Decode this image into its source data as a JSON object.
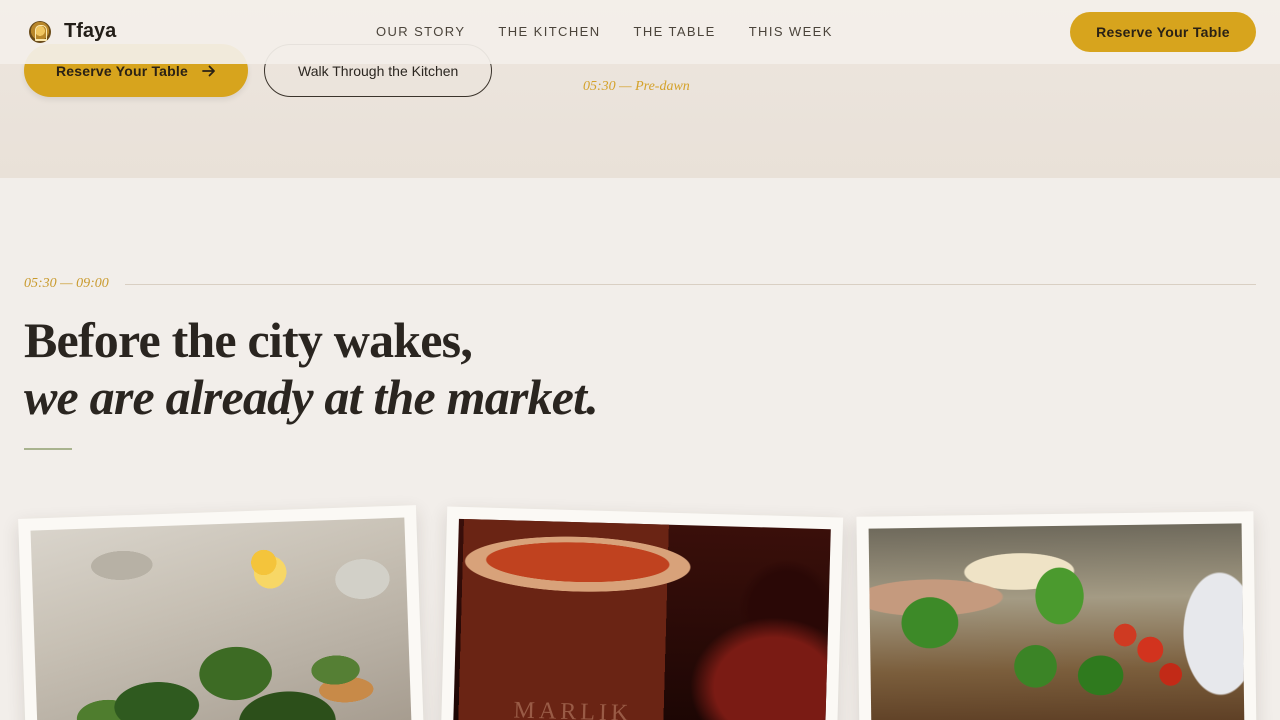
{
  "nav": {
    "brand": "Tfaya",
    "menu": [
      "OUR STORY",
      "THE KITCHEN",
      "THE TABLE",
      "THIS WEEK"
    ],
    "cta": "Reserve Your Table"
  },
  "hero": {
    "primary_cta": "Reserve Your Table",
    "primary_icon": "arrow-right-icon",
    "secondary_cta": "Walk Through the Kitchen",
    "time_label": "05:30 — Pre-dawn"
  },
  "section": {
    "time": "05:30 — 09:00",
    "headline_line1": "Before the city wakes,",
    "headline_line2": "we are already at the market.",
    "photos": [
      {
        "subject": "fresh herbs, lemons and spices on a wooden table"
      },
      {
        "subject": "saffron threads in a copper pot",
        "engraving": "MARLIK"
      },
      {
        "subject": "hands holding green peppers at a market stall"
      }
    ]
  },
  "colors": {
    "accent": "#d7a41d",
    "background": "#f2eeea",
    "text": "#2b2620",
    "time": "#c99a2d"
  }
}
